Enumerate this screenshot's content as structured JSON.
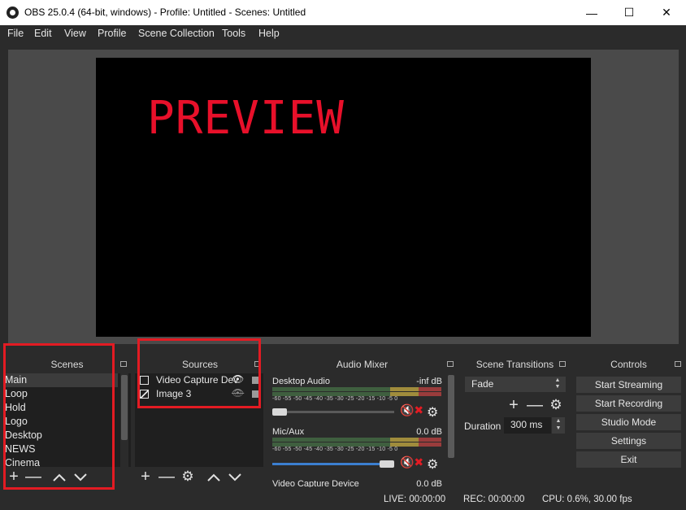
{
  "window": {
    "title": "OBS 25.0.4 (64-bit, windows) - Profile: Untitled - Scenes: Untitled"
  },
  "menu": [
    "File",
    "Edit",
    "View",
    "Profile",
    "Scene Collection",
    "Tools",
    "Help"
  ],
  "preview": {
    "text": "PREVIEW"
  },
  "docks": {
    "scenes": "Scenes",
    "sources": "Sources",
    "mixer": "Audio Mixer",
    "transitions": "Scene Transitions",
    "controls": "Controls"
  },
  "scenes": [
    "Main",
    "Loop",
    "Hold",
    "Logo",
    "Desktop",
    "NEWS",
    "Cinema"
  ],
  "sources": [
    {
      "name": "Video Capture Dev"
    },
    {
      "name": "Image 3"
    }
  ],
  "mixer": {
    "channels": [
      {
        "name": "Desktop Audio",
        "db": "-inf dB"
      },
      {
        "name": "Mic/Aux",
        "db": "0.0 dB"
      },
      {
        "name": "Video Capture Device",
        "db": "0.0 dB"
      }
    ],
    "ticks": "-60 -55 -50 -45 -40 -35 -30 -25 -20 -15 -10 -5 0"
  },
  "transitions": {
    "selected": "Fade",
    "duration_label": "Duration",
    "duration_value": "300 ms"
  },
  "controls": [
    "Start Streaming",
    "Start Recording",
    "Studio Mode",
    "Settings",
    "Exit"
  ],
  "status": {
    "live": "LIVE: 00:00:00",
    "rec": "REC: 00:00:00",
    "cpu": "CPU: 0.6%, 30.00 fps"
  },
  "colors": {
    "accent_red": "#e31b23",
    "preview_text": "#e8102a",
    "bg": "#2b2b2b"
  }
}
